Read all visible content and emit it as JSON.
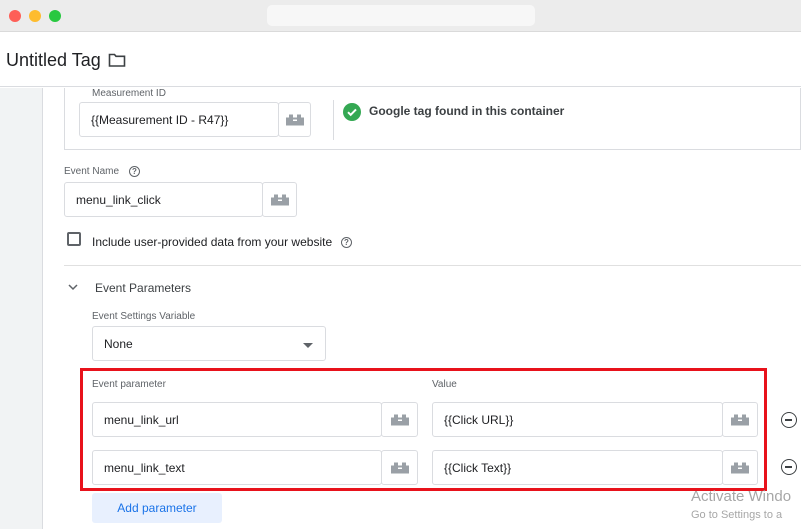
{
  "window": {
    "address_bar": ""
  },
  "tag": {
    "title": "Untitled Tag",
    "folder_icon": "folder-icon"
  },
  "measurement": {
    "label": "Measurement ID",
    "value": "{{Measurement ID - R47}}",
    "status": "Google tag found in this container",
    "status_color": "#34a853"
  },
  "event_name": {
    "label": "Event Name",
    "value": "menu_link_click"
  },
  "user_data": {
    "label": "Include user-provided data from your website",
    "checked": false
  },
  "event_parameters": {
    "title": "Event Parameters",
    "settings_variable": {
      "label": "Event Settings Variable",
      "value": "None"
    },
    "column_parameter": "Event parameter",
    "column_value": "Value",
    "rows": [
      {
        "parameter": "menu_link_url",
        "value": "{{Click URL}}"
      },
      {
        "parameter": "menu_link_text",
        "value": "{{Click Text}}"
      }
    ],
    "add_button": "Add parameter",
    "highlight_color": "#e8121b"
  },
  "watermark": {
    "line1": "Activate Windo",
    "line2": "Go to Settings to a"
  }
}
